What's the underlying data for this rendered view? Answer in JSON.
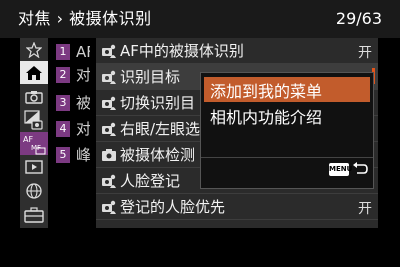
{
  "header": {
    "breadcrumb": "对焦 › 被摄体识别",
    "page_counter": "29/63"
  },
  "tabs": [
    {
      "icon": "star-icon"
    },
    {
      "icon": "camera-mode-icon",
      "active": true
    },
    {
      "icon": "camera-icon"
    },
    {
      "icon": "exposure-icon"
    },
    {
      "icon": "af-mf-icon"
    },
    {
      "icon": "playback-icon"
    },
    {
      "icon": "network-icon"
    },
    {
      "icon": "toolbox-icon"
    }
  ],
  "subtabs": [
    {
      "num": "1",
      "peek": "AF"
    },
    {
      "num": "2",
      "peek": "对"
    },
    {
      "num": "3",
      "peek": "被"
    },
    {
      "num": "4",
      "peek": "对"
    },
    {
      "num": "5",
      "peek": "峰"
    }
  ],
  "menu_items": [
    {
      "label": "AF中的被摄体识别",
      "value": "开",
      "icon": "camera-person-icon"
    },
    {
      "label": "识别目标",
      "value": "",
      "icon": "camera-person-icon",
      "selected": true
    },
    {
      "label": "切换识别目",
      "value": "",
      "icon": "camera-person-icon"
    },
    {
      "label": "右眼/左眼选",
      "value": "",
      "icon": "camera-person-icon"
    },
    {
      "label": "被摄体检测",
      "value": "",
      "icon": "camera-icon"
    },
    {
      "label": "人脸登记",
      "value": "",
      "icon": "camera-person-icon"
    },
    {
      "label": "登记的人脸优先",
      "value": "开",
      "icon": "camera-person-icon"
    }
  ],
  "popup": {
    "items": [
      {
        "label": "添加到我的菜单"
      },
      {
        "label": "相机内功能介绍"
      }
    ],
    "menu_key_label": "MENU"
  },
  "colors": {
    "accent": "#c25c2c",
    "tab_active": "#e9e9e9",
    "subtab": "#7c3a82"
  }
}
